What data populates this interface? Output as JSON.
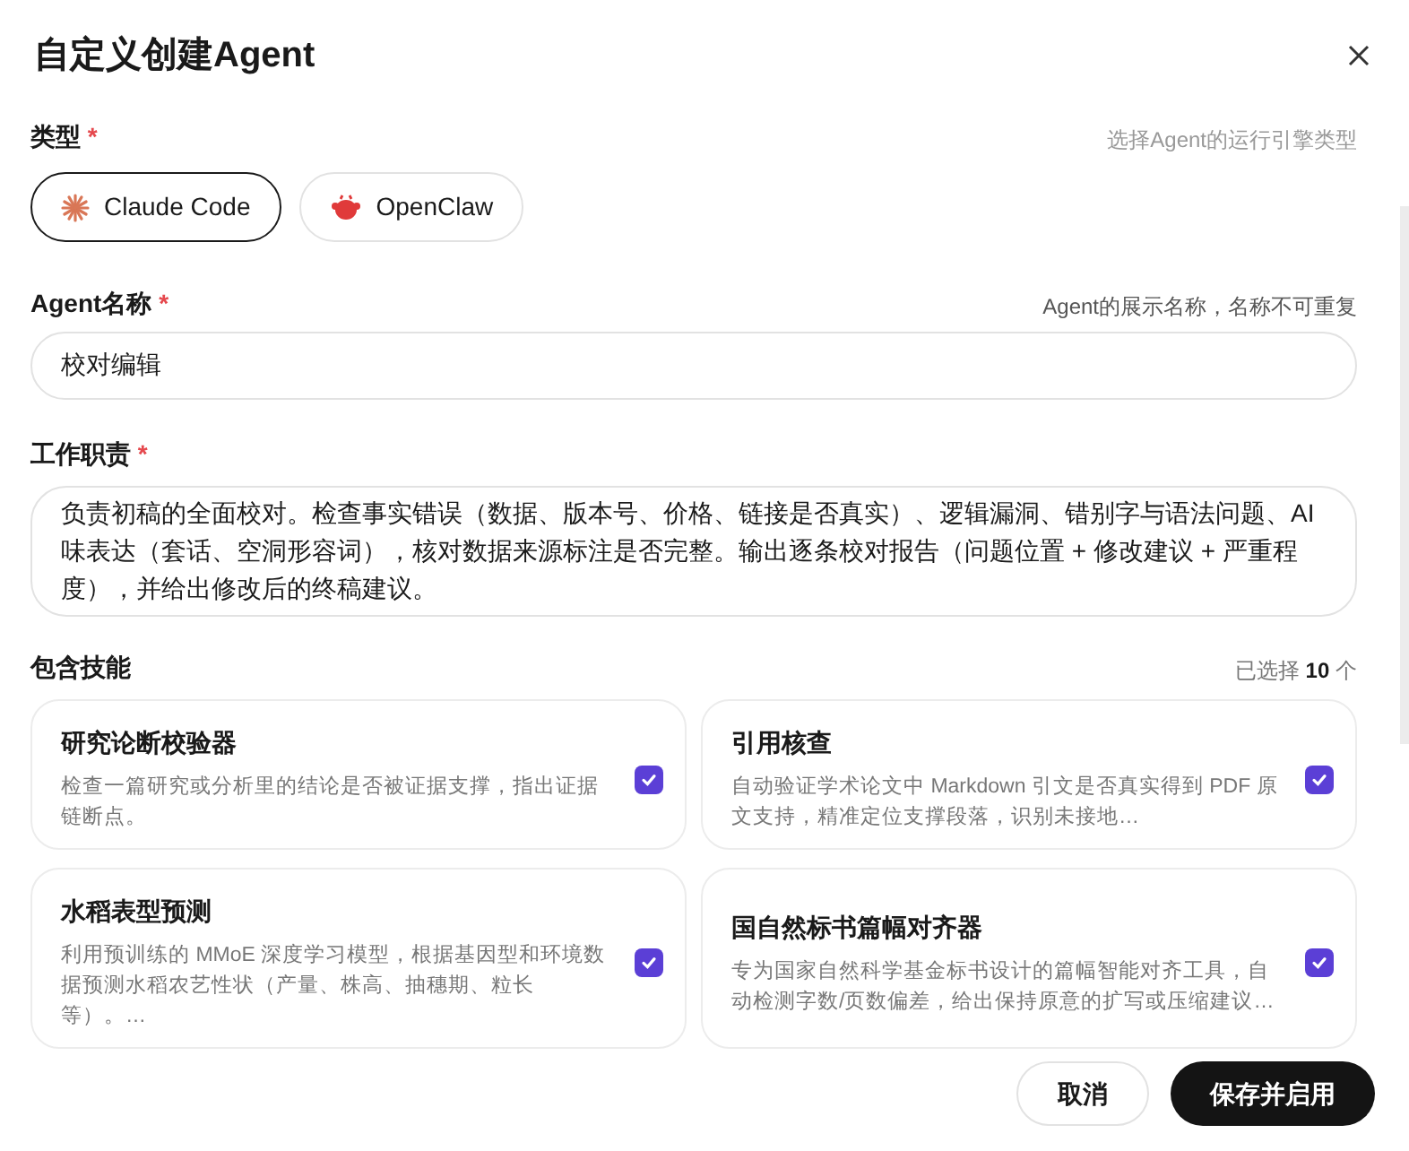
{
  "dialog": {
    "title": "自定义创建Agent"
  },
  "type_field": {
    "label": "类型",
    "required": "*",
    "hint": "选择Agent的运行引擎类型",
    "options": [
      {
        "label": "Claude Code",
        "kind": "claude",
        "selected": true
      },
      {
        "label": "OpenClaw",
        "kind": "openclaw",
        "selected": false
      }
    ]
  },
  "name_field": {
    "label": "Agent名称",
    "required": "*",
    "hint": "Agent的展示名称，名称不可重复",
    "value": "校对编辑"
  },
  "duty_field": {
    "label": "工作职责",
    "required": "*",
    "value": "负责初稿的全面校对。检查事实错误（数据、版本号、价格、链接是否真实）、逻辑漏洞、错别字与语法问题、AI味表达（套话、空洞形容词），核对数据来源标注是否完整。输出逐条校对报告（问题位置 + 修改建议 + 严重程度），并给出修改后的终稿建议。"
  },
  "skills": {
    "label": "包含技能",
    "count_prefix": "已选择",
    "count": "10",
    "count_suffix": "个",
    "items": [
      {
        "name": "研究论断校验器",
        "description": "检查一篇研究或分析里的结论是否被证据支撑，指出证据链断点。",
        "checked": true
      },
      {
        "name": "引用核查",
        "description": "自动验证学术论文中 Markdown 引文是否真实得到 PDF 原文支持，精准定位支撑段落，识别未接地…",
        "checked": true
      },
      {
        "name": "水稻表型预测",
        "description": "利用预训练的 MMoE 深度学习模型，根据基因型和环境数据预测水稻农艺性状（产量、株高、抽穗期、粒长等）。…",
        "checked": true
      },
      {
        "name": "国自然标书篇幅对齐器",
        "description": "专为国家自然科学基金标书设计的篇幅智能对齐工具，自动检测字数/页数偏差，给出保持原意的扩写或压缩建议…",
        "checked": true
      }
    ]
  },
  "footer": {
    "cancel": "取消",
    "save": "保存并启用"
  }
}
